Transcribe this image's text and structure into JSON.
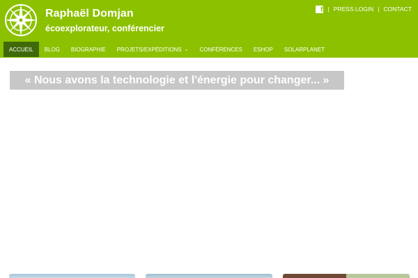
{
  "header": {
    "title": "Raphaël Domjan",
    "tagline": "écoexplorateur, conférencier",
    "logo_icon": "compass-rose-icon",
    "background_color": "#8cc100"
  },
  "topbar": {
    "facebook_icon": "facebook-icon",
    "separator": "|",
    "press_login": "PRESS LOGIN",
    "contact": "CONTACT"
  },
  "nav": {
    "items": [
      {
        "label": "ACCUEIL",
        "active": true
      },
      {
        "label": "BLOG"
      },
      {
        "label": "BIOGRAPHIE"
      },
      {
        "label": "PROJETS/EXPÉDITIONS",
        "has_dropdown": true
      },
      {
        "label": "CONFÉRENCES"
      },
      {
        "label": "ESHOP"
      },
      {
        "label": "SOLARPLANET"
      }
    ],
    "active_color": "#3f6a0a"
  },
  "main": {
    "quote": "« Nous avons la technologie et l'énergie pour changer... »"
  }
}
